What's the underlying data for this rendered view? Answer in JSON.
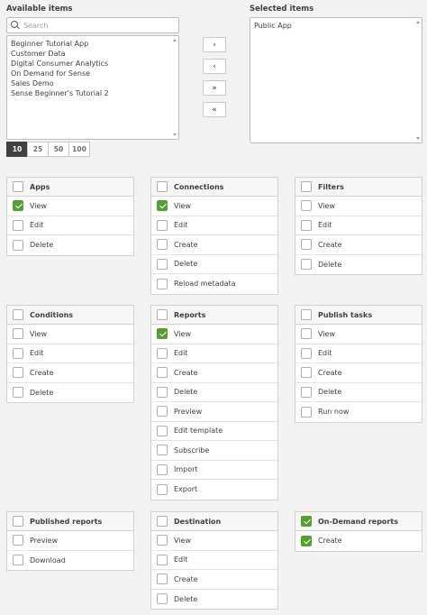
{
  "available": {
    "heading": "Available items",
    "search_placeholder": "Search",
    "items": [
      "Beginner Tutorial App",
      "Customer Data",
      "Digital Consumer Analytics",
      "On Demand for Sense",
      "Sales Demo",
      "Sense Beginner's Tutorial 2"
    ]
  },
  "selected": {
    "heading": "Selected items",
    "items": [
      "Public App"
    ]
  },
  "move_buttons": {
    "add": "›",
    "remove": "‹",
    "add_all": "»",
    "remove_all": "«"
  },
  "page_sizes": [
    "10",
    "25",
    "50",
    "100"
  ],
  "active_page_size": "10",
  "cards": [
    {
      "title": "Apps",
      "checked": false,
      "rows": [
        {
          "label": "View",
          "checked": true
        },
        {
          "label": "Edit",
          "checked": false
        },
        {
          "label": "Delete",
          "checked": false
        }
      ]
    },
    {
      "title": "Connections",
      "checked": false,
      "rows": [
        {
          "label": "View",
          "checked": true
        },
        {
          "label": "Edit",
          "checked": false
        },
        {
          "label": "Create",
          "checked": false
        },
        {
          "label": "Delete",
          "checked": false
        },
        {
          "label": "Reload metadata",
          "checked": false
        }
      ]
    },
    {
      "title": "Filters",
      "checked": false,
      "rows": [
        {
          "label": "View",
          "checked": false
        },
        {
          "label": "Edit",
          "checked": false
        },
        {
          "label": "Create",
          "checked": false
        },
        {
          "label": "Delete",
          "checked": false
        }
      ]
    },
    {
      "title": "Conditions",
      "checked": false,
      "rows": [
        {
          "label": "View",
          "checked": false
        },
        {
          "label": "Edit",
          "checked": false
        },
        {
          "label": "Create",
          "checked": false
        },
        {
          "label": "Delete",
          "checked": false
        }
      ]
    },
    {
      "title": "Reports",
      "checked": false,
      "rows": [
        {
          "label": "View",
          "checked": true
        },
        {
          "label": "Edit",
          "checked": false
        },
        {
          "label": "Create",
          "checked": false
        },
        {
          "label": "Delete",
          "checked": false
        },
        {
          "label": "Preview",
          "checked": false
        },
        {
          "label": "Edit template",
          "checked": false
        },
        {
          "label": "Subscribe",
          "checked": false
        },
        {
          "label": "Import",
          "checked": false
        },
        {
          "label": "Export",
          "checked": false
        }
      ]
    },
    {
      "title": "Publish tasks",
      "checked": false,
      "rows": [
        {
          "label": "View",
          "checked": false
        },
        {
          "label": "Edit",
          "checked": false
        },
        {
          "label": "Create",
          "checked": false
        },
        {
          "label": "Delete",
          "checked": false
        },
        {
          "label": "Run now",
          "checked": false
        }
      ]
    },
    {
      "title": "Published reports",
      "checked": false,
      "rows": [
        {
          "label": "Preview",
          "checked": false
        },
        {
          "label": "Download",
          "checked": false
        }
      ]
    },
    {
      "title": "Destination",
      "checked": false,
      "rows": [
        {
          "label": "View",
          "checked": false
        },
        {
          "label": "Edit",
          "checked": false
        },
        {
          "label": "Create",
          "checked": false
        },
        {
          "label": "Delete",
          "checked": false
        }
      ]
    },
    {
      "title": "On-Demand reports",
      "checked": true,
      "rows": [
        {
          "label": "Create",
          "checked": true
        }
      ]
    }
  ],
  "colors": {
    "check_green": "#52a02f",
    "active_page": "#404040",
    "background": "#f2f2f2"
  }
}
